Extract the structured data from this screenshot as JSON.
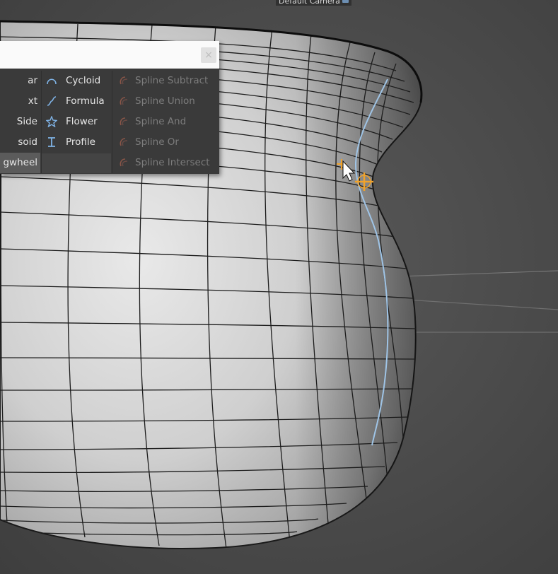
{
  "viewport": {
    "camera_label": "Default Camera",
    "background_color": "#484848",
    "accent_color": "#f0a22a",
    "spline_color": "#9fc4e6"
  },
  "spline_menu": {
    "search": {
      "value": "",
      "placeholder": "",
      "clear_label": "×"
    },
    "left_column": [
      {
        "label": "ar"
      },
      {
        "label": "xt"
      },
      {
        "label": "Side"
      },
      {
        "label": "soid"
      },
      {
        "label": "gwheel"
      }
    ],
    "middle_column": [
      {
        "label": "Cycloid",
        "icon": "cycloid-icon"
      },
      {
        "label": "Formula",
        "icon": "formula-icon"
      },
      {
        "label": "Flower",
        "icon": "flower-icon"
      },
      {
        "label": "Profile",
        "icon": "profile-icon"
      }
    ],
    "right_column": [
      {
        "label": "Spline Subtract",
        "icon": "spline-subtract-icon",
        "enabled": false
      },
      {
        "label": "Spline Union",
        "icon": "spline-union-icon",
        "enabled": false
      },
      {
        "label": "Spline And",
        "icon": "spline-and-icon",
        "enabled": false
      },
      {
        "label": "Spline Or",
        "icon": "spline-or-icon",
        "enabled": false
      },
      {
        "label": "Spline Intersect",
        "icon": "spline-intersect-icon",
        "enabled": false
      }
    ]
  }
}
